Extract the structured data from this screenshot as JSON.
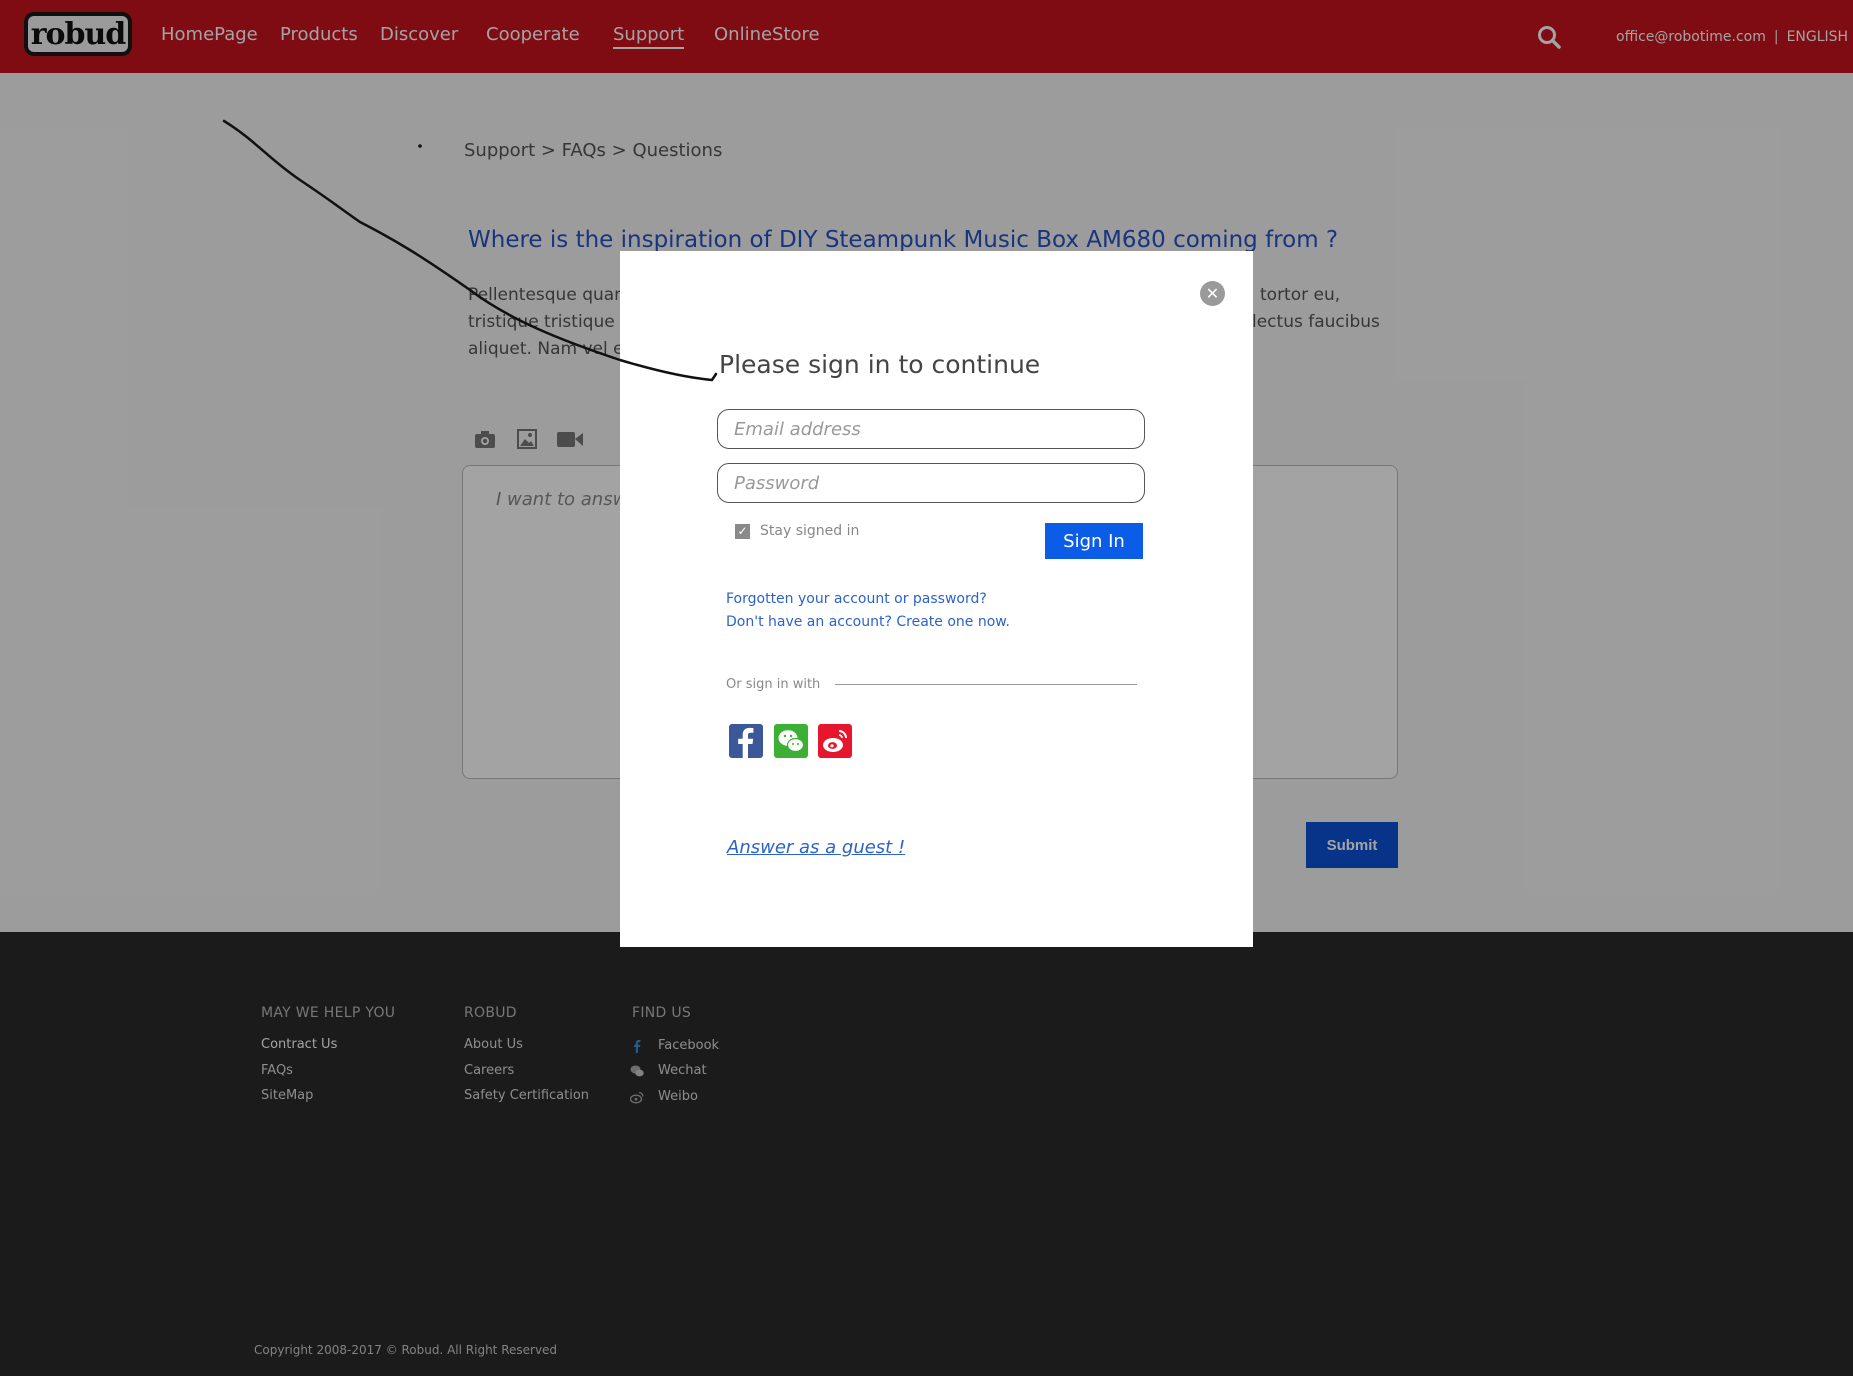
{
  "header": {
    "logo_text": "robud",
    "nav": [
      "HomePage",
      "Products",
      "Discover",
      "Cooperate",
      "Support",
      "OnlineStore"
    ],
    "active_nav": "Support",
    "email": "office@robotime.com",
    "separator": "|",
    "language": "ENGLISH"
  },
  "breadcrumb": "Support > FAQs > Questions",
  "question": {
    "title": "Where is the inspiration of DIY Steampunk Music Box AM680 coming from ?",
    "body_line1_start": "Pellentesque quan",
    "body_line1_end": "tortor eu,",
    "body_line2_start": "tristique tristique e",
    "body_line2_end": "lectus faucibus",
    "body_line3_start": "aliquet. Nam vel e"
  },
  "answer": {
    "placeholder": "I want to answ",
    "submit_label": "Submit"
  },
  "modal": {
    "close_symbol": "✕",
    "title": "Please sign in to continue",
    "email_placeholder": "Email address",
    "password_placeholder": "Password",
    "stay_signed_in": "Stay signed in",
    "stay_checked": true,
    "signin_label": "Sign In",
    "forgot_link": "Forgotten your account or password?",
    "create_link": "Don't have an account? Create one now.",
    "or_sign_in_with": "Or sign in with",
    "social": [
      "facebook",
      "wechat",
      "weibo"
    ],
    "guest_link": "Answer as a guest !"
  },
  "footer": {
    "help_heading": "MAY WE HELP YOU",
    "help_links": [
      "Contract Us",
      "FAQs",
      "SiteMap"
    ],
    "robud_heading": "ROBUD",
    "robud_links": [
      "About Us",
      "Careers",
      "Safety Certification"
    ],
    "find_heading": "FIND US",
    "find_links": [
      "Facebook",
      "Wechat",
      "Weibo"
    ],
    "copyright": "Copyright 2008-2017 © Robud. All Right Reserved"
  },
  "colors": {
    "header_red": "#c8141e",
    "link_blue": "#2b63c9",
    "button_blue": "#0b5ce6",
    "facebook": "#3b5998",
    "wechat": "#3cb034",
    "weibo": "#e6162d"
  }
}
